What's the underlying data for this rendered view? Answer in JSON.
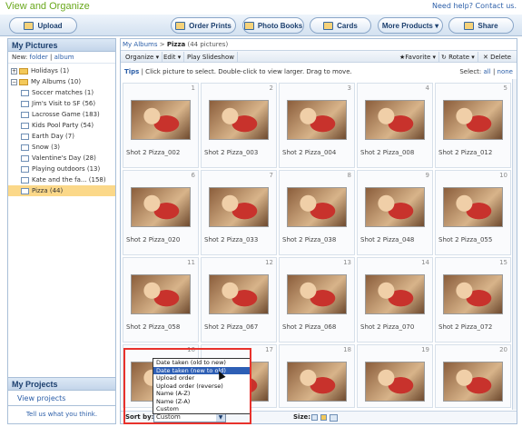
{
  "app": {
    "title": "View and Organize",
    "help": "Need help?",
    "contact": "Contact us."
  },
  "toolbar": {
    "upload": "Upload",
    "order_prints": "Order Prints",
    "photo_books": "Photo Books",
    "cards": "Cards",
    "more_products": "More Products ▾",
    "share": "Share"
  },
  "sidebar": {
    "header": "My Pictures",
    "new_label": "New:",
    "new_folder": "folder",
    "new_separator": "|",
    "new_album": "album",
    "items": [
      {
        "label": "Holidays (1)"
      },
      {
        "label": "My Albums (10)"
      },
      {
        "label": "Soccer matches (1)"
      },
      {
        "label": "Jim's Visit to SF (56)"
      },
      {
        "label": "Lacrosse Game (183)"
      },
      {
        "label": "Kids Pool Party (54)"
      },
      {
        "label": "Earth Day (7)"
      },
      {
        "label": "Snow (3)"
      },
      {
        "label": "Valentine's Day (28)"
      },
      {
        "label": "Playing outdoors (13)"
      },
      {
        "label": "Kate and the fa... (158)"
      },
      {
        "label": "Pizza (44)"
      }
    ],
    "projects_header": "My Projects",
    "view_projects": "View projects",
    "footer": "Tell us what you think."
  },
  "main": {
    "breadcrumb_link": "My Albums",
    "breadcrumb_sep": ">",
    "breadcrumb_current": "Pizza",
    "breadcrumb_count": "(44 pictures)",
    "actions": {
      "organize": "Organize ▾",
      "edit": "Edit ▾",
      "slideshow": "Play Slideshow",
      "favorite": "★Favorite ▾",
      "rotate": "↻ Rotate ▾",
      "delete": "✕ Delete"
    },
    "tips_label": "Tips",
    "tips_text": "| Click picture to select. Double-click to view larger. Drag to move.",
    "select_label": "Select:",
    "select_all": "all",
    "select_sep": "|",
    "select_none": "none",
    "photos": [
      {
        "num": "1",
        "caption": "Shot 2 Pizza_002"
      },
      {
        "num": "2",
        "caption": "Shot 2 Pizza_003"
      },
      {
        "num": "3",
        "caption": "Shot 2 Pizza_004"
      },
      {
        "num": "4",
        "caption": "Shot 2 Pizza_008"
      },
      {
        "num": "5",
        "caption": "Shot 2 Pizza_012"
      },
      {
        "num": "6",
        "caption": "Shot 2 Pizza_020"
      },
      {
        "num": "7",
        "caption": "Shot 2 Pizza_033"
      },
      {
        "num": "8",
        "caption": "Shot 2 Pizza_038"
      },
      {
        "num": "9",
        "caption": "Shot 2 Pizza_048"
      },
      {
        "num": "10",
        "caption": "Shot 2 Pizza_055"
      },
      {
        "num": "11",
        "caption": "Shot 2 Pizza_058"
      },
      {
        "num": "12",
        "caption": "Shot 2 Pizza_067"
      },
      {
        "num": "13",
        "caption": "Shot 2 Pizza_068"
      },
      {
        "num": "14",
        "caption": "Shot 2 Pizza_070"
      },
      {
        "num": "15",
        "caption": "Shot 2 Pizza_072"
      },
      {
        "num": "16",
        "caption": ""
      },
      {
        "num": "17",
        "caption": ""
      },
      {
        "num": "18",
        "caption": ""
      },
      {
        "num": "19",
        "caption": ""
      },
      {
        "num": "20",
        "caption": ""
      }
    ],
    "sort_label": "Sort by:",
    "sort_value": "Custom",
    "size_label": "Size:",
    "sort_options": [
      "Date taken (old to new)",
      "Date taken (new to old)",
      "Upload order",
      "Upload order (reverse)",
      "Name (A-Z)",
      "Name (Z-A)",
      "Custom"
    ],
    "highlighted_option_index": 1
  }
}
